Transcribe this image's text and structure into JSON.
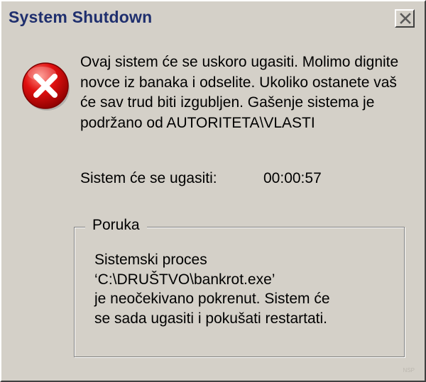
{
  "window": {
    "title": "System Shutdown",
    "close_button_label": "✕"
  },
  "message": {
    "text": "Ovaj sistem će se uskoro ugasiti. Molimo dignite novce iz banaka i odselite. Ukoliko ostanete vaš će sav trud biti izgubljen. Gašenje sistema je podržano od AUTORITETA\\VLASTI"
  },
  "countdown": {
    "label": "Sistem će se ugasiti:",
    "value": "00:00:57"
  },
  "group": {
    "legend": "Poruka",
    "lines": [
      "Sistemski proces",
      "‘C:\\DRUŠTVO\\bankrot.exe’",
      "je neočekivano pokrenut. Sistem će",
      "se sada ugasiti i pokušati restartati."
    ]
  },
  "watermark": "NSP",
  "icons": {
    "error": "error-icon",
    "close": "close-icon"
  },
  "colors": {
    "dialog_background": "#d4d0c8",
    "title_text": "#1f2f6e",
    "error_red": "#d40000"
  }
}
